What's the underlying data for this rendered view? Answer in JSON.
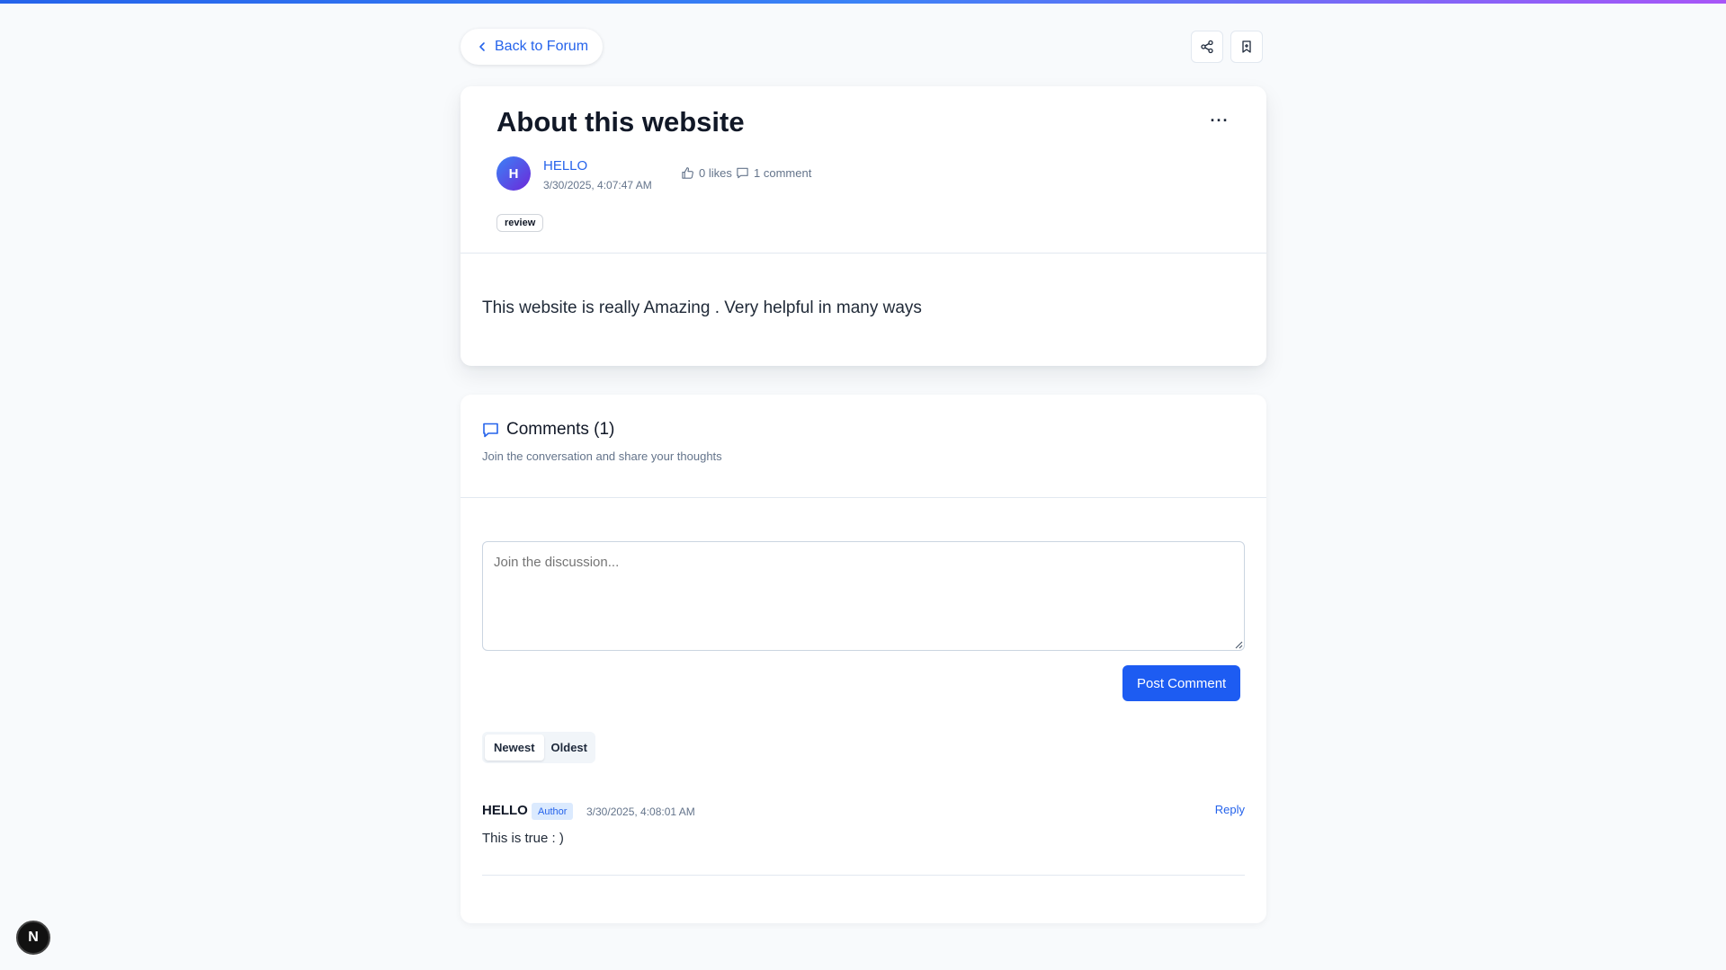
{
  "nav": {
    "back_label": "Back to Forum",
    "share_icon": "share-icon",
    "bookmark_icon": "bookmark-icon"
  },
  "post": {
    "title": "About this website",
    "more_label": "···",
    "author": {
      "initial": "H",
      "name": "HELLO",
      "date": "3/30/2025, 4:07:47 AM"
    },
    "likes_label": "0 likes",
    "comments_label": "1 comment",
    "tag": "review",
    "body": "This website is really Amazing . Very helpful in many ways"
  },
  "comments": {
    "title": "Comments (1)",
    "subtitle": "Join the conversation and share your thoughts",
    "input_placeholder": "Join the discussion...",
    "post_button": "Post Comment",
    "sort_options": [
      "Newest",
      "Oldest"
    ],
    "sort_selected": "Newest",
    "items": [
      {
        "author": "HELLO",
        "badge": "Author",
        "date": "3/30/2025, 4:08:01 AM",
        "reply_label": "Reply",
        "text": "This is true : )"
      }
    ]
  },
  "dev_badge": {
    "label": "N"
  },
  "colors": {
    "accent": "#2563eb",
    "primary_button": "#1d5cf2",
    "background": "#f8fafc",
    "badge_bg": "#dbeafe"
  }
}
